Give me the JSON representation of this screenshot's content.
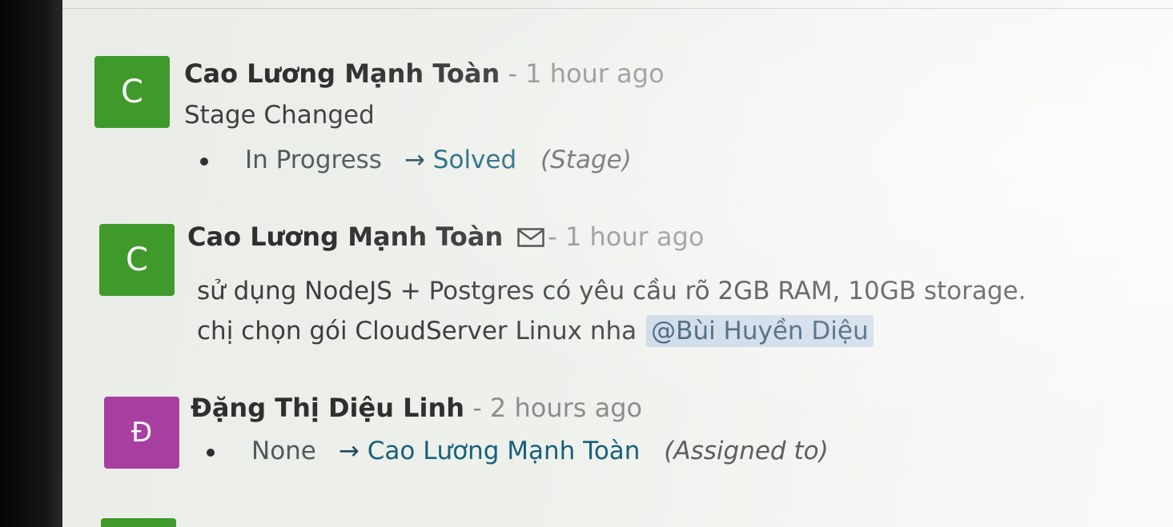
{
  "messages": [
    {
      "avatar_letter": "C",
      "author": "Cao Lương Mạnh Toàn",
      "time": "- 1 hour ago",
      "subject": "Stage Changed",
      "change": {
        "old": "In Progress",
        "arrow": "→",
        "new": "Solved",
        "field": "(Stage)"
      }
    },
    {
      "avatar_letter": "C",
      "author": "Cao Lương Mạnh Toàn",
      "time": "- 1 hour ago",
      "icon": "envelope-icon",
      "body_line1": "sử dụng NodeJS + Postgres có yêu cầu rõ 2GB RAM, 10GB storage.",
      "body_line2": "chị chọn gói CloudServer Linux nha",
      "mention": "@Bùi Huyền Diệu"
    },
    {
      "avatar_letter": "Đ",
      "author": "Đặng Thị Diệu Linh",
      "time": "- 2 hours ago",
      "change": {
        "old": "None",
        "arrow": "→",
        "new": "Cao Lương Mạnh Toàn",
        "field": "(Assigned to)"
      }
    }
  ],
  "colors": {
    "avatar_green": "#3f9a2b",
    "avatar_magenta": "#a63f9f",
    "link": "#17617a",
    "mention_bg": "#adc4e1"
  }
}
